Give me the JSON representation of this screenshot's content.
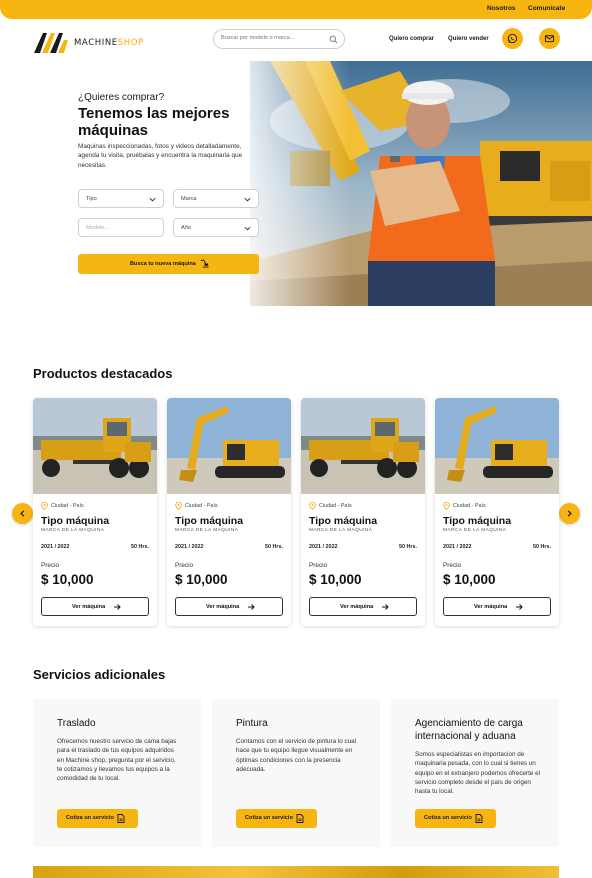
{
  "topbar": {
    "links": [
      "Nosotros",
      "Comunícate"
    ]
  },
  "header": {
    "logo": {
      "part1": "MACHINE",
      "part2": "SHOP"
    },
    "search": {
      "placeholder": "Buscar por modelo o marca..."
    },
    "nav": [
      "Quiero comprar",
      "Quiero vender"
    ],
    "icons": [
      "whatsapp-icon",
      "mail-icon"
    ]
  },
  "hero": {
    "pre_title": "¿Quieres comprar?",
    "title": "Tenemos las mejores máquinas",
    "description": "Maquinas inspeccionadas, fotos y videos detalladamente, agenda tu visita, pruébalas y encuentra la maquinaria que necesitas.",
    "filters": {
      "tipo": "Tipo",
      "marca": "Marca",
      "modelo_placeholder": "Modelo...",
      "anio": "Año"
    },
    "cta_label": "Busca tu nueva máquina"
  },
  "featured": {
    "title": "Productos destacados",
    "cards": [
      {
        "image": "motor-grader",
        "location": "Ciudad - País",
        "type": "Tipo máquina",
        "brand": "MARCA DE LA MAQUINA",
        "year": "2021 / 2022",
        "hours": "50 Hrs.",
        "price_label": "Precio",
        "price": "$ 10,000",
        "button": "Ver máquina"
      },
      {
        "image": "excavator",
        "location": "Ciudad - País",
        "type": "Tipo máquina",
        "brand": "MARCA DE LA MAQUINA",
        "year": "2021 / 2022",
        "hours": "50 Hrs.",
        "price_label": "Precio",
        "price": "$ 10,000",
        "button": "Ver máquina"
      },
      {
        "image": "motor-grader",
        "location": "Ciudad - País",
        "type": "Tipo máquina",
        "brand": "MARCA DE LA MAQUINA",
        "year": "2021 / 2022",
        "hours": "50 Hrs.",
        "price_label": "Precio",
        "price": "$ 10,000",
        "button": "Ver máquina"
      },
      {
        "image": "excavator",
        "location": "Ciudad - País",
        "type": "Tipo máquina",
        "brand": "MARCA DE LA MAQUINA",
        "year": "2021 / 2022",
        "hours": "50 Hrs.",
        "price_label": "Precio",
        "price": "$ 10,000",
        "button": "Ver máquina"
      }
    ]
  },
  "services": {
    "title": "Servicios adicionales",
    "items": [
      {
        "title": "Traslado",
        "description": "Ofrecemos nuestro servicio de cama bajas para el traslado de tus equipos adquiridos en Machine shop, pregunta por el servicio, te cotizamos y llevamos tus equipos a la comodidad de tu local.",
        "button": "Cotiza un servicio"
      },
      {
        "title": "Pintura",
        "description": "Contamos con el servicio de pintura lo cual hace que tu equipo llegue visualmente en óptimas condiciones con la presencia adecuada.",
        "button": "Cotiza un servicio"
      },
      {
        "title": "Agenciamiento de carga internacional y aduana",
        "description": "Somos especialistas en importacion de maquinaria pesada, con lo cual si tienes un equipo en el extranjero podemos ofrecerte el servicio completo desde el país de origen hasta tu local.",
        "button": "Cotiza un servicio"
      }
    ]
  },
  "colors": {
    "accent": "#f7b512",
    "text": "#111111",
    "card_bg": "#ffffff",
    "service_bg": "#f8f8f8"
  }
}
